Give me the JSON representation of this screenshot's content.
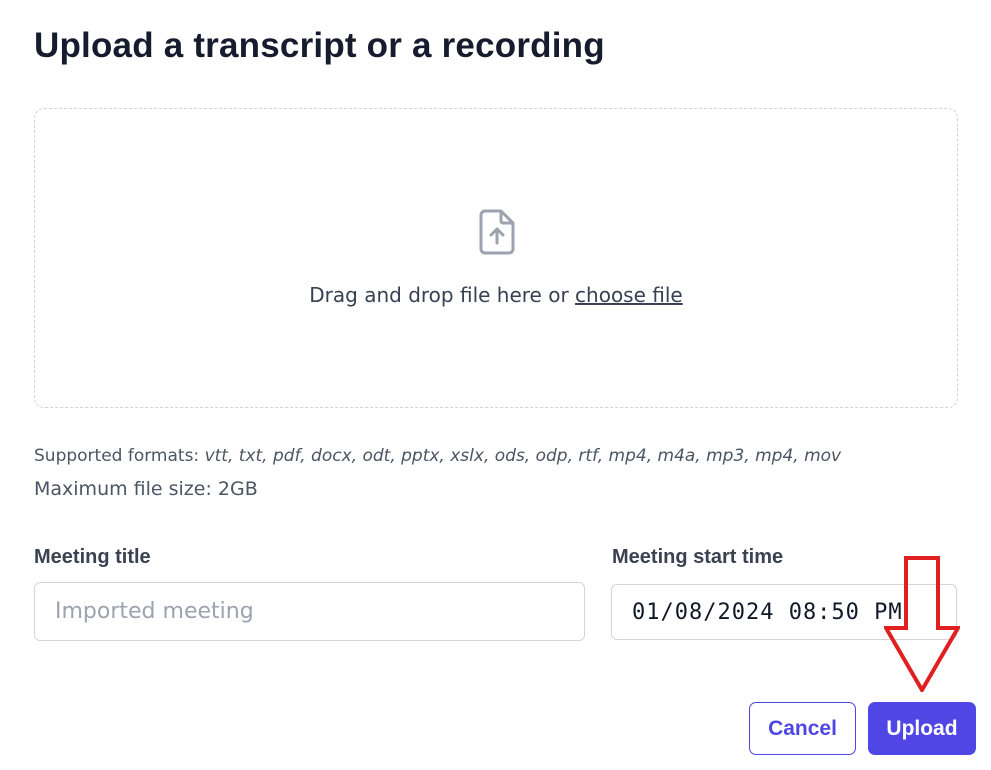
{
  "header": {
    "title": "Upload a transcript or a recording"
  },
  "dropzone": {
    "icon": "file-upload-icon",
    "text": "Drag and drop file here or ",
    "link": "choose file"
  },
  "info": {
    "formats_label": "Supported formats: ",
    "formats_list": "vtt, txt, pdf, docx, odt, pptx, xslx, ods, odp, rtf, mp4, m4a, mp3, mp4, mov",
    "max_size_label": "Maximum file size: ",
    "max_size_value": "2GB"
  },
  "form": {
    "title_label": "Meeting title",
    "title_placeholder": "Imported meeting",
    "title_value": "",
    "start_label": "Meeting start time",
    "start_value": "01/08/2024 08:50 PM"
  },
  "actions": {
    "cancel": "Cancel",
    "upload": "Upload"
  },
  "colors": {
    "accent": "#4f46e5",
    "annotation": "#e02020"
  }
}
